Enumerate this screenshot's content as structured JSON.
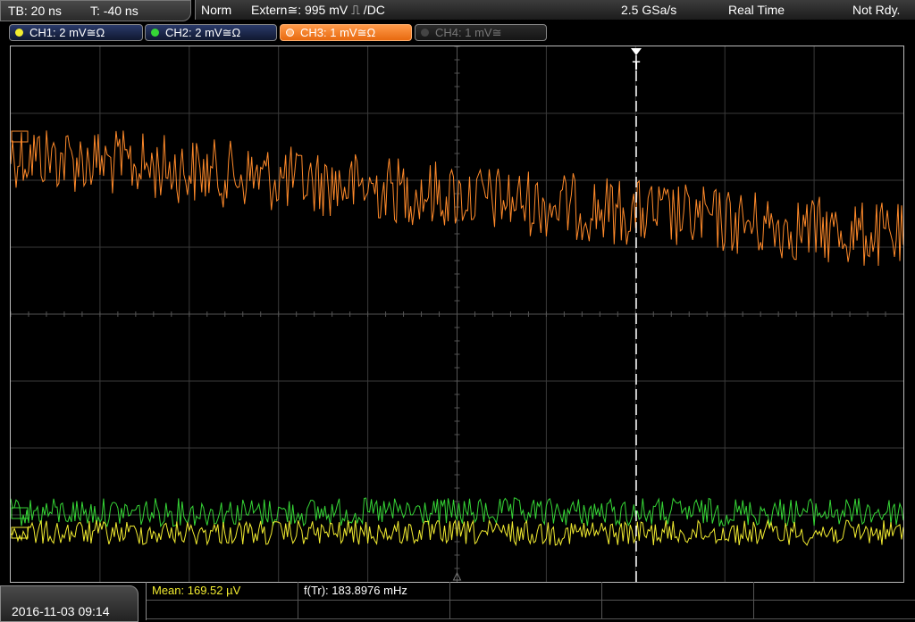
{
  "timebase": {
    "tb": "TB: 20 ns",
    "trig_offset": "T: -40 ns"
  },
  "status": {
    "mode": "Norm",
    "trigger": "Extern≅: 995 mV ⎍ /DC",
    "sample_rate": "2.5 GSa/s",
    "acq": "Real Time",
    "state": "Not Rdy."
  },
  "channels": [
    {
      "label": "CH1: 2 mV≅Ω",
      "color": "#f2ec30",
      "state": "enabled"
    },
    {
      "label": "CH2: 2 mV≅Ω",
      "color": "#36d636",
      "state": "enabled"
    },
    {
      "label": "CH3: 1 mV≅Ω",
      "color": "#ff8a2a",
      "state": "active"
    },
    {
      "label": "CH4: 1 mV≅",
      "color": "#888888",
      "state": "disabled"
    }
  ],
  "trigger_marker": "T",
  "timestamp": "2016-11-03 09:14",
  "measurements": {
    "mean": "Mean: 169.52 µV",
    "freq": "f(Tr): 183.8976 mHz"
  },
  "waveform_colors": {
    "ch1": "#f2ec30",
    "ch2": "#36d636",
    "ch3": "#ff8a2a"
  }
}
